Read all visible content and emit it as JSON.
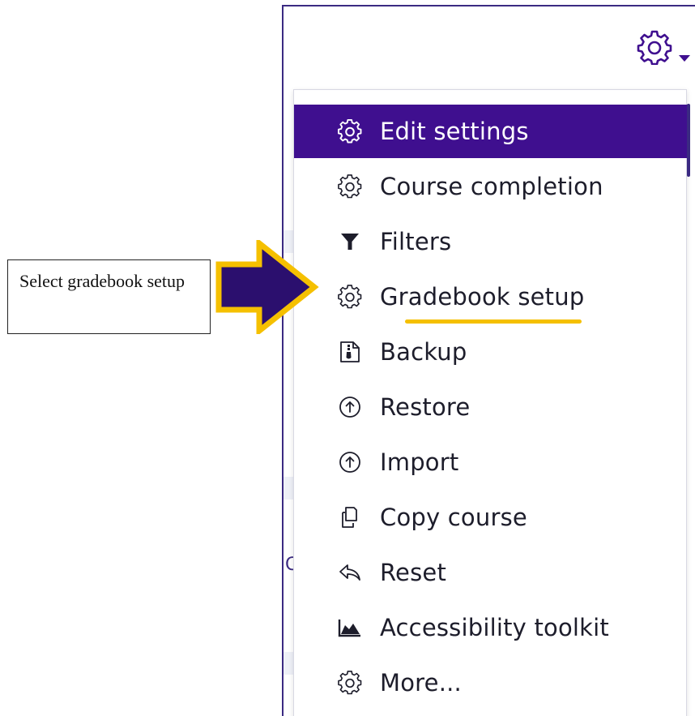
{
  "gear_menu": {
    "trigger_icon": "gear-icon",
    "caret_icon": "caret-down-icon"
  },
  "menu": {
    "items": [
      {
        "label": "Edit settings",
        "icon": "gear-icon",
        "active": true
      },
      {
        "label": "Course completion",
        "icon": "gear-icon"
      },
      {
        "label": "Filters",
        "icon": "filter-icon"
      },
      {
        "label": "Gradebook setup",
        "icon": "gear-icon"
      },
      {
        "label": "Backup",
        "icon": "backup-file-icon"
      },
      {
        "label": "Restore",
        "icon": "arrow-up-circle-icon"
      },
      {
        "label": "Import",
        "icon": "arrow-up-circle-icon"
      },
      {
        "label": "Copy course",
        "icon": "copy-icon"
      },
      {
        "label": "Reset",
        "icon": "reset-arrow-icon"
      },
      {
        "label": "Accessibility toolkit",
        "icon": "mountain-chart-icon"
      },
      {
        "label": "More...",
        "icon": "gear-icon"
      }
    ]
  },
  "background": {
    "partial_link_letter": "C"
  },
  "annotation": {
    "callout_text": "Select gradebook setup",
    "highlighted_item": "Gradebook setup"
  },
  "colors": {
    "brand": "#3f0f8f",
    "highlight": "#f5c000",
    "arrow_fill": "#2b0f6e"
  }
}
